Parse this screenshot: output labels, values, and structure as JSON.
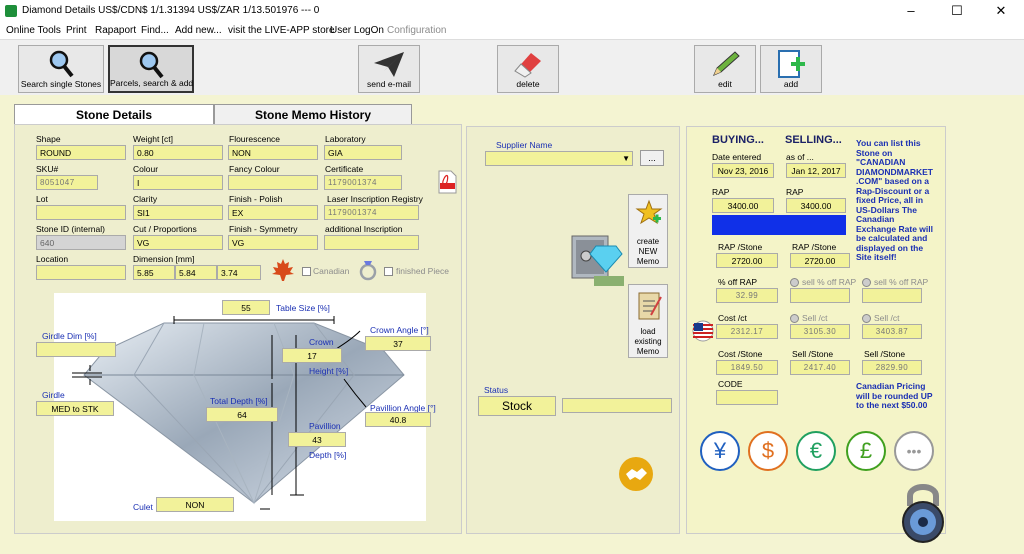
{
  "window": {
    "title": "Diamond Details US$/CDN$ 1/1.31394 US$/ZAR 1/13.501976   ---   0",
    "controls": [
      "–",
      "☐",
      "✕"
    ]
  },
  "menu": [
    "Online Tools",
    "Print",
    "Rapaport",
    "Find...",
    "Add new...",
    "visit the LIVE-APP store",
    "User LogOn",
    "Configuration"
  ],
  "toolbar": {
    "search_single": "Search single Stones",
    "parcels": "Parcels, search & add",
    "send_email": "send e-mail",
    "delete": "delete",
    "edit": "edit",
    "add": "add"
  },
  "tabs": {
    "stone_details": "Stone Details",
    "memo_history": "Stone Memo History"
  },
  "details": {
    "shape": {
      "label": "Shape",
      "value": "ROUND"
    },
    "weight": {
      "label": "Weight [ct]",
      "value": "0.80"
    },
    "fluorescence": {
      "label": "Flourescence",
      "value": "NON"
    },
    "laboratory": {
      "label": "Laboratory",
      "value": "GIA"
    },
    "sku": {
      "label": "SKU#",
      "value": "8051047"
    },
    "colour": {
      "label": "Colour",
      "value": "I"
    },
    "fancy_colour": {
      "label": "Fancy Colour",
      "value": ""
    },
    "certificate": {
      "label": "Certificate",
      "value": "1179001374"
    },
    "lot": {
      "label": "Lot",
      "value": ""
    },
    "clarity": {
      "label": "Clarity",
      "value": "SI1"
    },
    "polish": {
      "label": "Finish - Polish",
      "value": "EX"
    },
    "laser": {
      "label": "Laser Inscription Registry",
      "value": "1179001374"
    },
    "stone_id": {
      "label": "Stone ID (internal)",
      "value": "640"
    },
    "cut": {
      "label": "Cut / Proportions",
      "value": "VG"
    },
    "symmetry": {
      "label": "Finish - Symmetry",
      "value": "VG"
    },
    "additional": {
      "label": "additional Inscription",
      "value": ""
    },
    "location": {
      "label": "Location",
      "value": ""
    },
    "dimension": {
      "label": "Dimension [mm]",
      "v1": "5.85",
      "v2": "5.84",
      "v3": "3.74"
    },
    "canadian": "Canadian",
    "finished": "finished Piece"
  },
  "diagram": {
    "table_size": {
      "label": "Table Size [%]",
      "value": "55"
    },
    "girdle_dim": {
      "label": "Girdle Dim [%]",
      "value": ""
    },
    "crown_angle": {
      "label": "Crown Angle [°]",
      "value": "37"
    },
    "crown": {
      "label": "Crown",
      "value": "17"
    },
    "height": "Height [%]",
    "girdle": {
      "label": "Girdle",
      "value": "MED to STK"
    },
    "total_depth": {
      "label": "Total Depth [%]",
      "value": "64"
    },
    "pavillion_angle": {
      "label": "Pavillion Angle [°]",
      "value": "40.8"
    },
    "pavillion": {
      "label": "Pavillion",
      "value": "43"
    },
    "depth": "Depth [%]",
    "culet": {
      "label": "Culet",
      "value": "NON"
    }
  },
  "middle": {
    "supplier_label": "Supplier Name",
    "supplier_btn": "...",
    "create_memo": [
      "create",
      "NEW",
      "Memo"
    ],
    "load_memo": [
      "load",
      "existing",
      "Memo"
    ],
    "status_label": "Status",
    "status_value": "Stock"
  },
  "pricing": {
    "buying": "BUYING...",
    "selling": "SELLING...",
    "date_entered_label": "Date entered",
    "date_entered": "Nov 23, 2016",
    "as_of_label": "as of ...",
    "as_of": "Jan 12, 2017",
    "rap_label": "RAP",
    "rap_buy": "3400.00",
    "rap_sell": "3400.00",
    "rap_stone_label": "RAP /Stone",
    "rap_stone_buy": "2720.00",
    "rap_stone_sell": "2720.00",
    "pct_off_label": "% off RAP",
    "pct_off_value": "32.99",
    "sell_pct_off_1": "sell % off RAP",
    "sell_pct_off_2": "sell % off RAP",
    "cost_ct_label": "Cost /ct",
    "cost_ct_value": "2312.17",
    "sell_ct_label_1": "Sell /ct",
    "sell_ct_value_1": "3105.30",
    "sell_ct_label_2": "Sell /ct",
    "sell_ct_value_2": "3403.87",
    "cost_stone_label": "Cost /Stone",
    "cost_stone_value": "1849.50",
    "sell_stone_label_1": "Sell /Stone",
    "sell_stone_value_1": "2417.40",
    "sell_stone_label_2": "Sell /Stone",
    "sell_stone_value_2": "2829.90",
    "code_label": "CODE",
    "code_value": ""
  },
  "notes": {
    "listing": [
      "You can list this",
      "Stone on",
      "\"CANADIAN",
      "DIAMONDMARKET",
      ".COM\" based on a",
      "Rap-Discount or a",
      "fixed Price, all in",
      "US-Dollars   The",
      "Canadian",
      "Exchange Rate will",
      "be calculated and",
      "displayed on the",
      "Site itself!"
    ],
    "pricing": [
      "Canadian Pricing",
      "will be rounded UP",
      "to the next $50.00"
    ]
  },
  "currencies": [
    {
      "symbol": "¥",
      "color": "#2060c0"
    },
    {
      "symbol": "$",
      "color": "#e07020"
    },
    {
      "symbol": "€",
      "color": "#20a060"
    },
    {
      "symbol": "£",
      "color": "#40a020"
    },
    {
      "symbol": "•••",
      "color": "#999999"
    }
  ]
}
